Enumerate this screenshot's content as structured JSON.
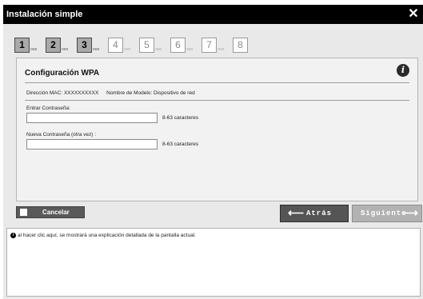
{
  "window": {
    "title": "Instalación simple",
    "close_icon": "close-icon"
  },
  "steps": [
    {
      "num": "1",
      "dots": "ooo",
      "state": "active"
    },
    {
      "num": "2",
      "dots": "ooo",
      "state": "active"
    },
    {
      "num": "3",
      "dots": "ooo",
      "state": "active"
    },
    {
      "num": "4",
      "dots": "ooo",
      "state": "inactive"
    },
    {
      "num": "5",
      "dots": "ooo",
      "state": "inactive"
    },
    {
      "num": "6",
      "dots": "ooo",
      "state": "inactive"
    },
    {
      "num": "7",
      "dots": "ooo",
      "state": "inactive"
    },
    {
      "num": "8",
      "dots": "",
      "state": "inactive"
    }
  ],
  "panel": {
    "title": "Configuración WPA",
    "info_icon_glyph": "i",
    "mac_label": "Dirección MAC: XXXXXXXXXX",
    "model_label": "Nombre de Modelo: Dispositivo de red",
    "password_label": "Entrar Contraseña:",
    "password_value": "",
    "password_hint": "8-63 caracteres",
    "new_password_label": "Nueva Contraseña (otra vez) :",
    "new_password_value": "",
    "new_password_hint": "8-63 caracteres"
  },
  "buttons": {
    "cancel": "Cancelar",
    "back": "Atrás",
    "next": "Siguiente"
  },
  "help": {
    "icon_glyph": "i",
    "text": "al hacer clic aquí, se mostrará una explicación detallada de la pantalla actual."
  },
  "colors": {
    "titlebar": "#000000",
    "active_step": "#a9a9a9",
    "back_button": "#555555",
    "next_button": "#b2b2b2"
  }
}
